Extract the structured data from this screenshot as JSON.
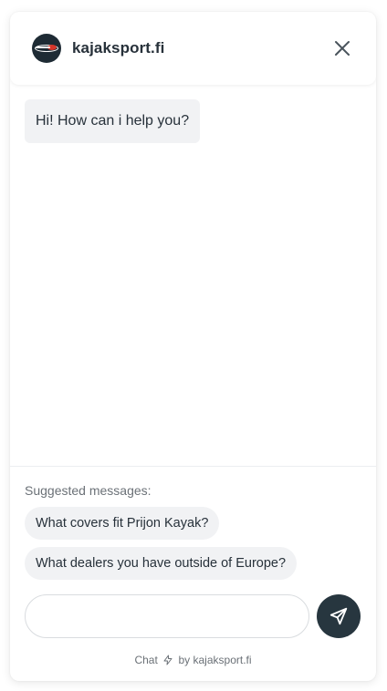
{
  "header": {
    "title": "kajaksport.fi",
    "avatar_icon": "kajaksport-logo-icon",
    "close_icon": "close-icon"
  },
  "messages": [
    {
      "from": "bot",
      "text": "Hi! How can i help you?"
    }
  ],
  "suggestions": {
    "label": "Suggested messages:",
    "items": [
      "What covers fit Prijon Kayak?",
      "What dealers you have outside of Europe?"
    ]
  },
  "composer": {
    "value": "",
    "placeholder": "",
    "send_icon": "send-icon"
  },
  "footer": {
    "prefix": "Chat",
    "bolt_icon": "bolt-icon",
    "suffix": "by kajaksport.fi"
  },
  "colors": {
    "accent": "#27363f",
    "bubble_bg": "#f1f2f4",
    "text": "#27313a",
    "muted": "#6b7177"
  }
}
